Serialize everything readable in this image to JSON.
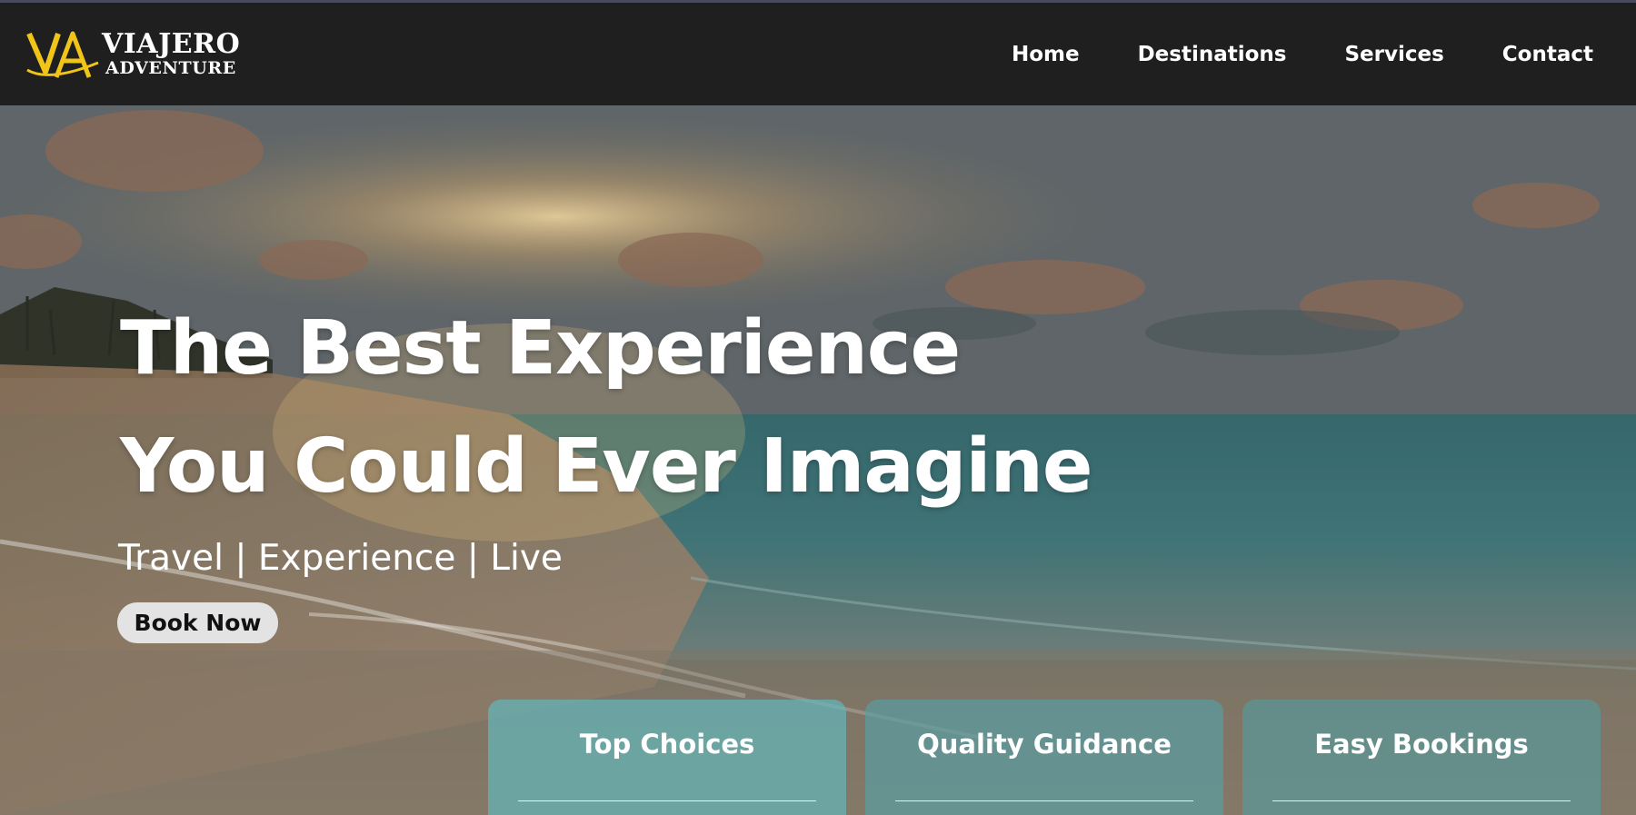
{
  "brand": {
    "mark": "VA",
    "title": "VIAJERO",
    "subtitle": "ADVENTURE",
    "accent_color": "#f0c419"
  },
  "nav": {
    "items": [
      {
        "label": "Home"
      },
      {
        "label": "Destinations"
      },
      {
        "label": "Services"
      },
      {
        "label": "Contact"
      }
    ]
  },
  "hero": {
    "title_line1": "The Best Experience",
    "title_line2": "You Could Ever Imagine",
    "tagline": "Travel | Experience | Live",
    "cta_label": "Book Now",
    "background": "beach-sunset-image"
  },
  "features": [
    {
      "title": "Top Choices"
    },
    {
      "title": "Quality Guidance"
    },
    {
      "title": "Easy Bookings"
    }
  ]
}
